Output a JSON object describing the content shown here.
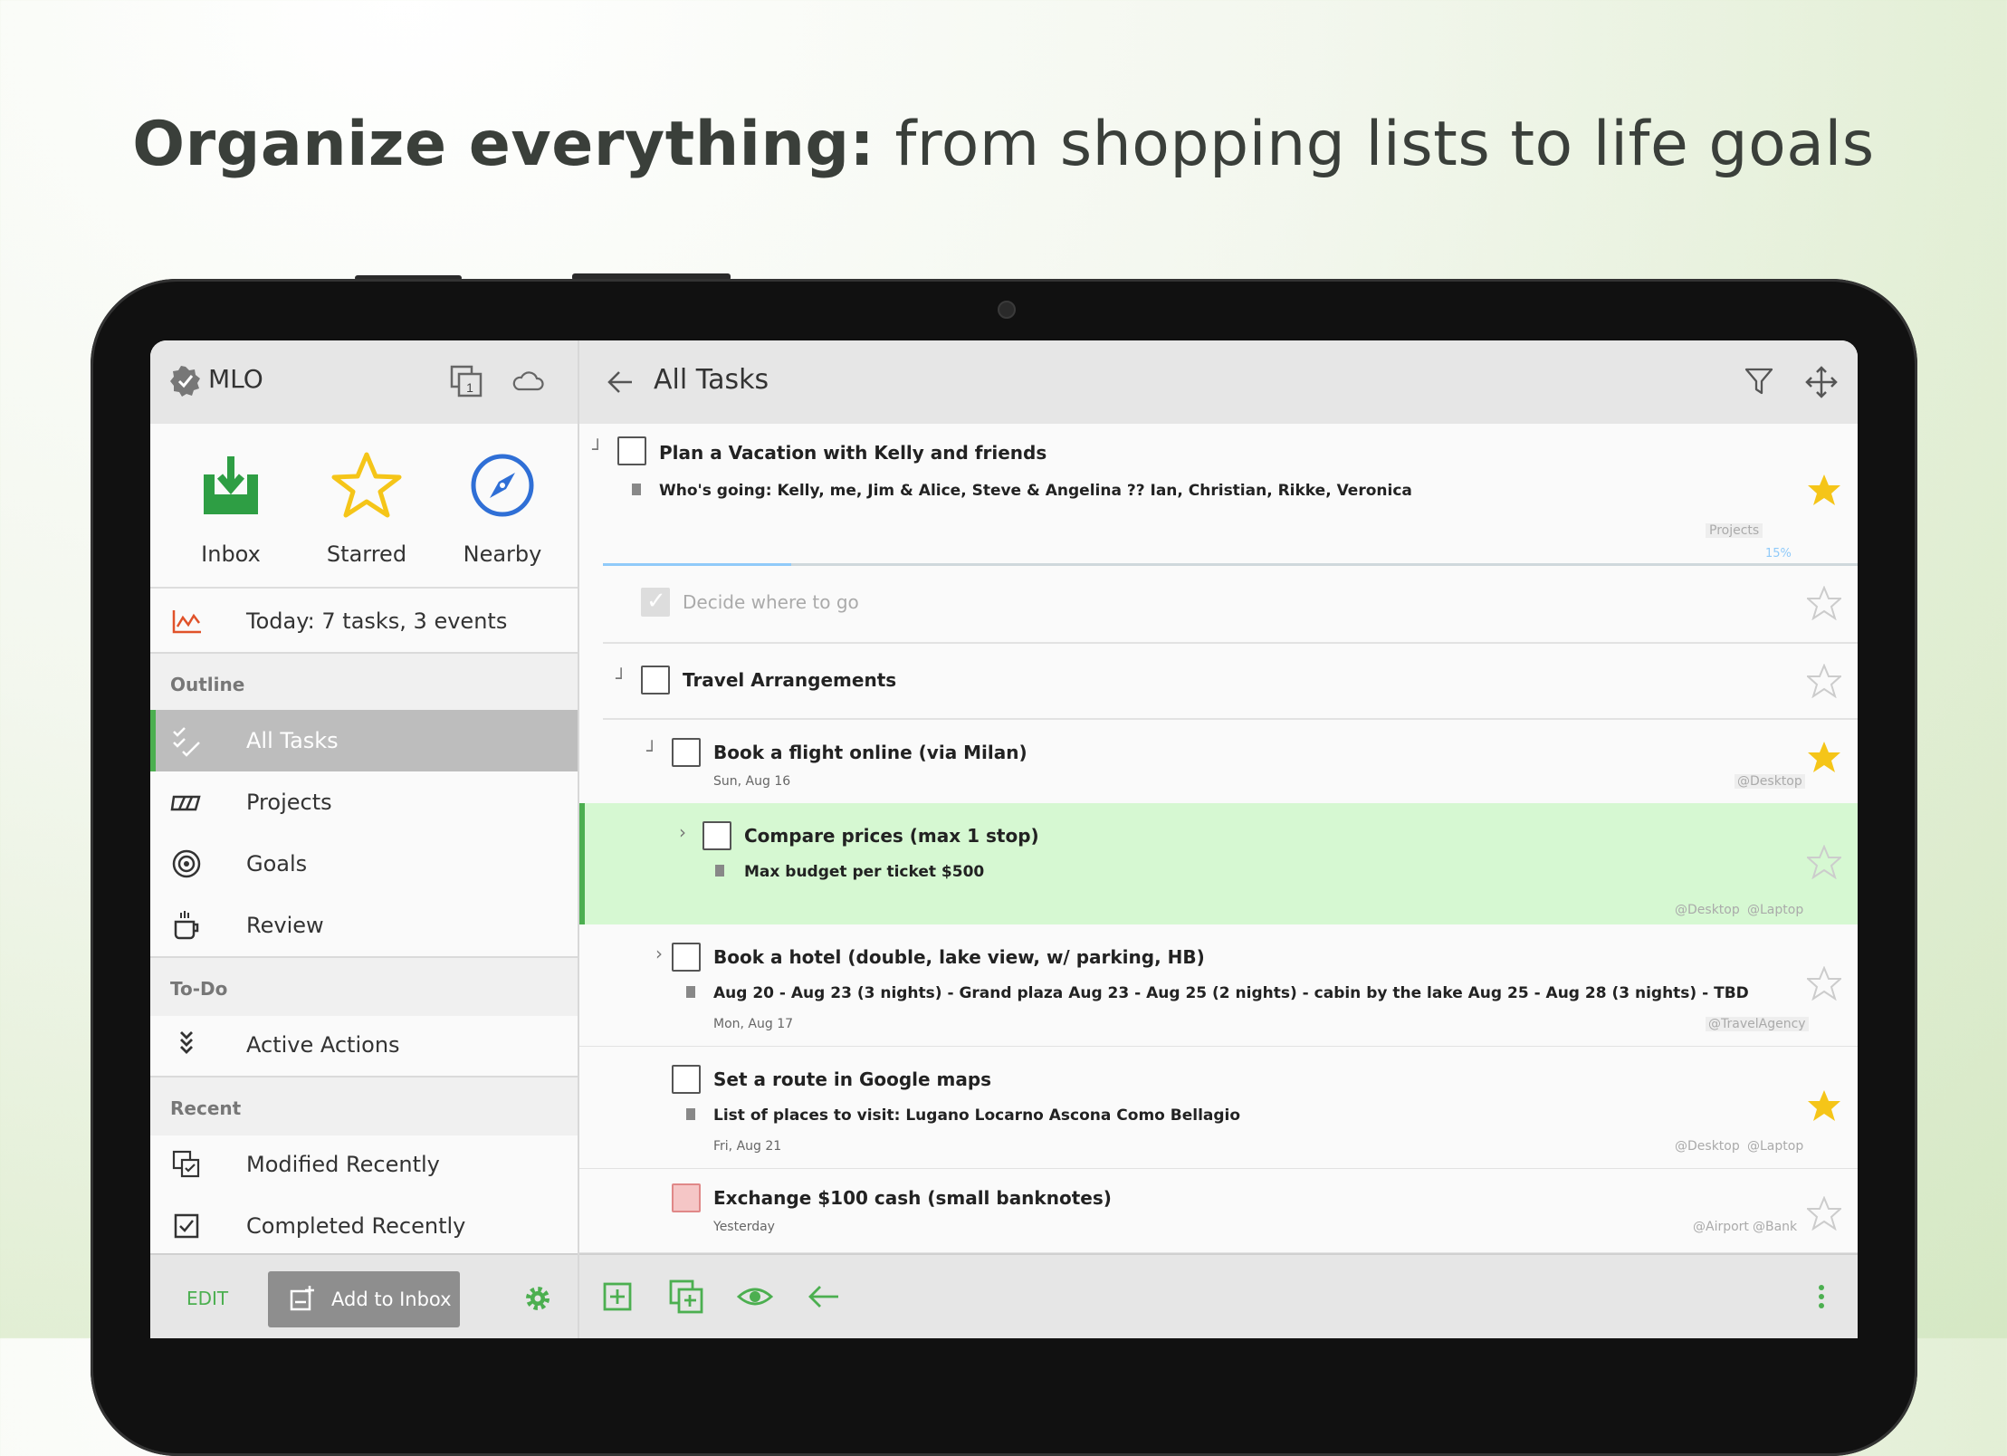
{
  "headline": {
    "bold": "Organize everything:",
    "light": "from shopping lists to life goals"
  },
  "sidebar": {
    "app_name": "MLO",
    "sync_badge": "1",
    "quick": [
      {
        "label": "Inbox",
        "icon": "inbox-icon"
      },
      {
        "label": "Starred",
        "icon": "star-icon"
      },
      {
        "label": "Nearby",
        "icon": "compass-icon"
      }
    ],
    "today": "Today: 7 tasks, 3 events",
    "sections": {
      "outline": "Outline",
      "todo": "To-Do",
      "recent": "Recent"
    },
    "outline_items": [
      {
        "label": "All Tasks",
        "icon": "all-tasks-icon",
        "active": true
      },
      {
        "label": "Projects",
        "icon": "projects-icon"
      },
      {
        "label": "Goals",
        "icon": "target-icon"
      },
      {
        "label": "Review",
        "icon": "coffee-icon"
      }
    ],
    "todo_items": [
      {
        "label": "Active Actions",
        "icon": "chevrons-down-icon"
      }
    ],
    "recent_items": [
      {
        "label": "Modified Recently",
        "icon": "modified-icon"
      },
      {
        "label": "Completed Recently",
        "icon": "checkbox-icon"
      }
    ],
    "footer": {
      "edit": "EDIT",
      "add_to_inbox": "Add to Inbox"
    }
  },
  "main": {
    "title": "All Tasks",
    "tasks": [
      {
        "title": "Plan a Vacation with Kelly and friends",
        "note": "Who's going: Kelly, me, Jim & Alice, Steve & Angelina ?? Ian, Christian, Rikke, Veronica",
        "context": "Projects",
        "progress_label": "15%",
        "progress": 0.15,
        "starred": true
      },
      {
        "title": "Decide where to go",
        "done": true,
        "starred": false
      },
      {
        "title": "Travel Arrangements",
        "starred": false
      },
      {
        "title": "Book a flight online (via Milan)",
        "date": "Sun, Aug 16",
        "context": "@Desktop",
        "starred": true
      },
      {
        "title": "Compare prices (max 1 stop)",
        "note": "Max budget per ticket $500",
        "context1": "@Desktop",
        "context2": "@Laptop",
        "starred": false
      },
      {
        "title": "Book a hotel (double, lake view, w/ parking, HB)",
        "note": "Aug 20 - Aug 23 (3 nights) - Grand plaza Aug 23 - Aug 25 (2 nights) - cabin by the lake Aug 25 - Aug 28 (3 nights) - TBD",
        "date": "Mon, Aug 17",
        "context": "@TravelAgency",
        "starred": false
      },
      {
        "title": "Set a route in Google maps",
        "note": "List of places to visit: Lugano Locarno Ascona Como Bellagio",
        "date": "Fri, Aug 21",
        "context1": "@Desktop",
        "context2": "@Laptop",
        "starred": true
      },
      {
        "title": "Exchange $100 cash (small banknotes)",
        "date": "Yesterday",
        "context1": "@Airport",
        "context2": "@Bank",
        "starred": false
      }
    ]
  },
  "colors": {
    "accent": "#4caf50",
    "star": "#f5c518",
    "selected_row": "#d6f8d2"
  }
}
